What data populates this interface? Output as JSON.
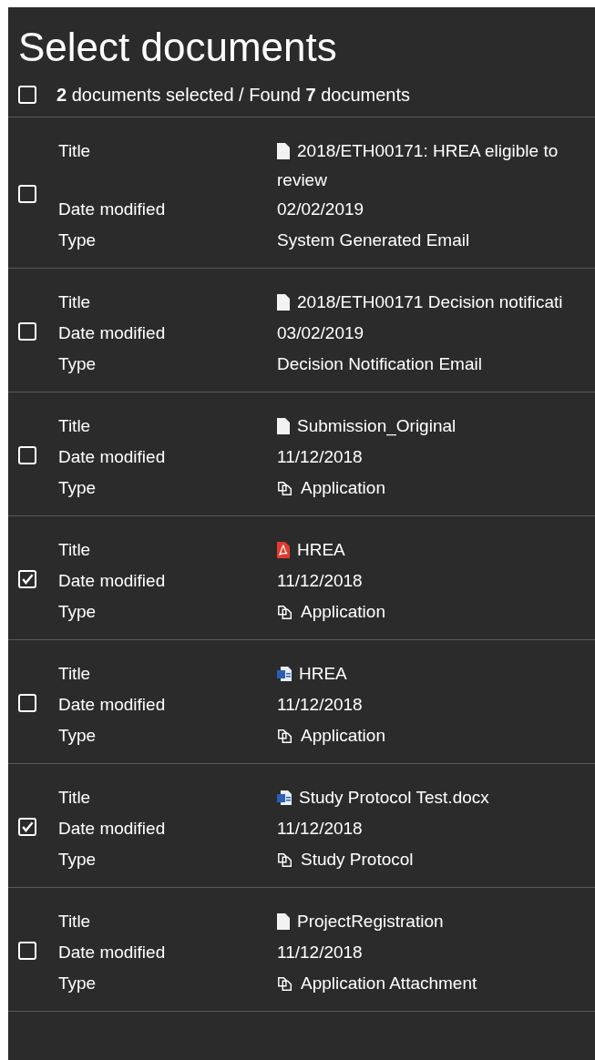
{
  "title": "Select documents",
  "summary": {
    "text": "**2** documents selected / Found **7** documents",
    "checked": false
  },
  "documents": [
    {
      "checked": false,
      "kind": "blank",
      "labels": [
        "Title",
        "Date modified",
        "Type"
      ],
      "title_lines": [
        "2018/ETH00171: HREA eligible to",
        "review"
      ],
      "date": "02/02/2019",
      "type": "System Generated Email",
      "type_icon": false
    },
    {
      "checked": false,
      "kind": "blank",
      "labels": [
        "Title",
        "Date modified",
        "Type"
      ],
      "title_lines": [
        "2018/ETH00171 Decision notificati"
      ],
      "date": "03/02/2019",
      "type": "Decision Notification Email",
      "type_icon": false
    },
    {
      "checked": false,
      "kind": "blank",
      "labels": [
        "Title",
        "Date modified",
        "Type"
      ],
      "title_lines": [
        "Submission_Original"
      ],
      "date": "11/12/2018",
      "type": "Application",
      "type_icon": true
    },
    {
      "checked": true,
      "kind": "pdf",
      "labels": [
        "Title",
        "Date modified",
        "Type"
      ],
      "title_lines": [
        "HREA"
      ],
      "date": "11/12/2018",
      "type": "Application",
      "type_icon": true
    },
    {
      "checked": false,
      "kind": "word",
      "labels": [
        "Title",
        "Date modified",
        "Type"
      ],
      "title_lines": [
        "HREA"
      ],
      "date": "11/12/2018",
      "type": "Application",
      "type_icon": true
    },
    {
      "checked": true,
      "kind": "word",
      "labels": [
        "Title",
        "Date modified",
        "Type"
      ],
      "title_lines": [
        "Study Protocol Test.docx"
      ],
      "date": "11/12/2018",
      "type": "Study Protocol",
      "type_icon": true
    },
    {
      "checked": false,
      "kind": "blank",
      "labels": [
        "Title",
        "Date modified",
        "Type"
      ],
      "title_lines": [
        "ProjectRegistration"
      ],
      "date": "11/12/2018",
      "type": "Application Attachment",
      "type_icon": true
    }
  ]
}
